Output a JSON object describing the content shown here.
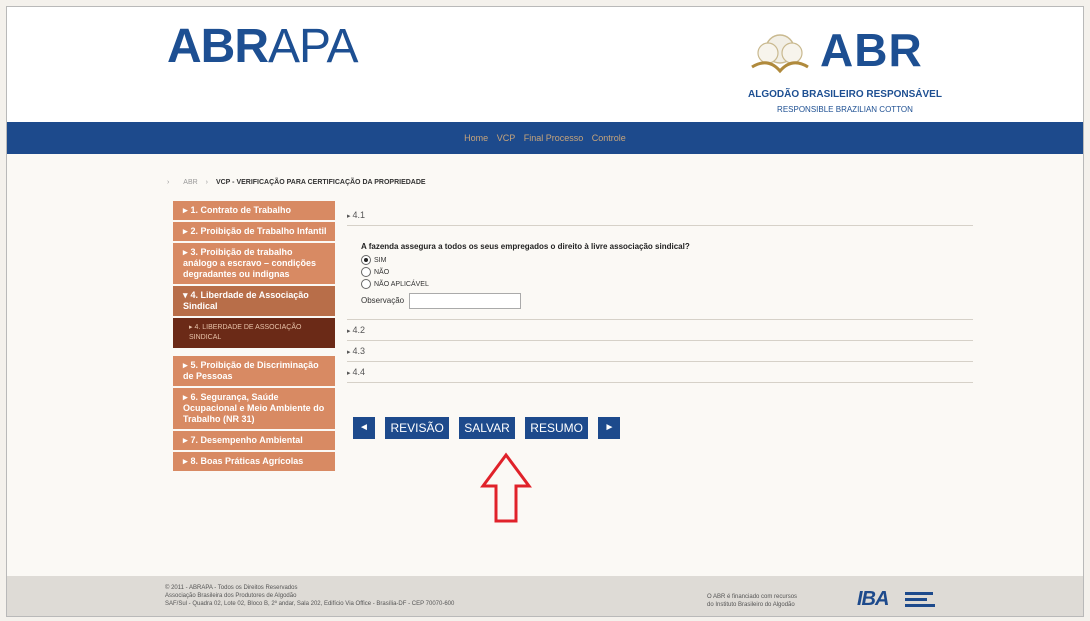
{
  "header": {
    "logo_left_bold": "ABR",
    "logo_left_rest": "APA",
    "logo_right": "ABR",
    "logo_right_line1": "ALGODÃO BRASILEIRO RESPONSÁVEL",
    "logo_right_line2": "RESPONSIBLE BRAZILIAN COTTON"
  },
  "nav": {
    "items": [
      "Home",
      "VCP",
      "Final Processo",
      "Controle"
    ]
  },
  "breadcrumb": {
    "root": "ABR",
    "current": "VCP - VERIFICAÇÃO PARA CERTIFICAÇÃO DA PROPRIEDADE"
  },
  "sidebar": {
    "items": [
      {
        "label": "1. Contrato de Trabalho"
      },
      {
        "label": "2. Proibição de Trabalho Infantil"
      },
      {
        "label": "3. Proibição de trabalho análogo a escravo – condições degradantes ou indignas"
      },
      {
        "label": "4. Liberdade de Associação Sindical"
      },
      {
        "label": "5. Proibição de Discriminação de Pessoas"
      },
      {
        "label": "6. Segurança, Saúde Ocupacional e Meio Ambiente do Trabalho (NR 31)"
      },
      {
        "label": "7. Desempenho Ambiental"
      },
      {
        "label": "8. Boas Práticas Agrícolas"
      }
    ],
    "sub_item": "4. LIBERDADE DE ASSOCIAÇÃO SINDICAL"
  },
  "main": {
    "sections": [
      "4.1",
      "4.2",
      "4.3",
      "4.4"
    ],
    "question": "A fazenda assegura a todos os seus empregados o direito à livre associação sindical?",
    "options": [
      "SIM",
      "NÃO",
      "NÃO APLICÁVEL"
    ],
    "selected_option": "SIM",
    "observation_label": "Observação"
  },
  "buttons": {
    "prev": "◄",
    "review": "REVISÃO",
    "save": "SALVAR",
    "summary": "RESUMO",
    "next": "►"
  },
  "footer": {
    "left_line1": "© 2011 - ABRAPA - Todos os Direitos Reservados",
    "left_line2": "Associação Brasileira dos Produtores de Algodão",
    "left_line3": "SAF/Sul - Quadra 02, Lote 02, Bloco B, 2º andar, Sala 202, Edifício Via Office - Brasília-DF - CEP 70070-600",
    "right_line1": "O ABR é financiado com recursos",
    "right_line2": "do Instituto Brasileiro do Algodão",
    "iba_logo": "IBA"
  },
  "colors": {
    "brand_blue": "#1d4a8c",
    "sidebar_orange": "#d88a63",
    "sidebar_sub_dark": "#6b2a17",
    "annotation_arrow": "#e0222a"
  }
}
